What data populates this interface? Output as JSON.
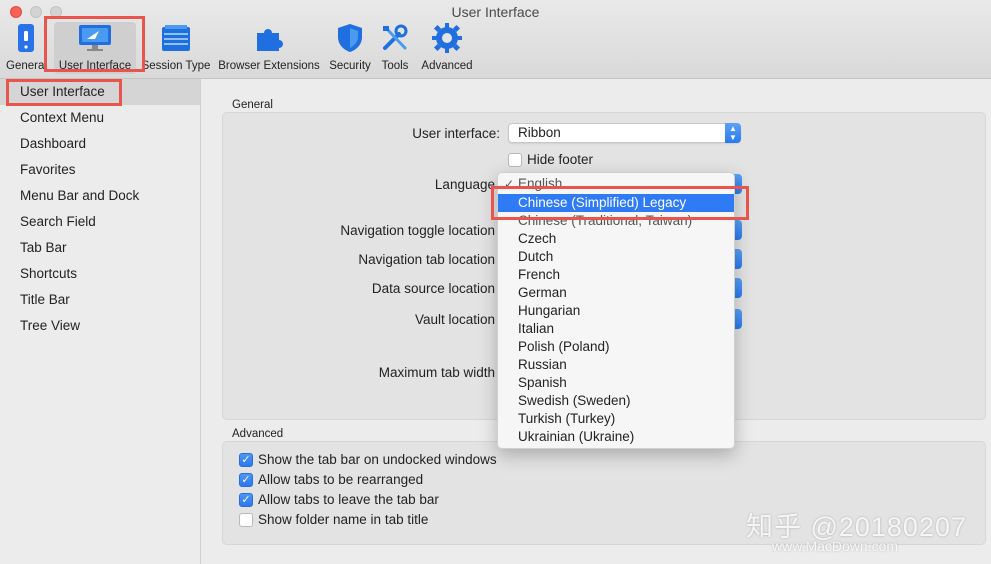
{
  "window": {
    "title": "User Interface"
  },
  "toolbar": {
    "items": [
      {
        "label": "General"
      },
      {
        "label": "User Interface"
      },
      {
        "label": "Session Type"
      },
      {
        "label": "Browser Extensions"
      },
      {
        "label": "Security"
      },
      {
        "label": "Tools"
      },
      {
        "label": "Advanced"
      }
    ]
  },
  "sidebar": {
    "items": [
      {
        "label": "User Interface"
      },
      {
        "label": "Context Menu"
      },
      {
        "label": "Dashboard"
      },
      {
        "label": "Favorites"
      },
      {
        "label": "Menu Bar and Dock"
      },
      {
        "label": "Search Field"
      },
      {
        "label": "Tab Bar"
      },
      {
        "label": "Shortcuts"
      },
      {
        "label": "Title Bar"
      },
      {
        "label": "Tree View"
      }
    ]
  },
  "general": {
    "section_label": "General",
    "user_interface_label": "User interface:",
    "user_interface_value": "Ribbon",
    "hide_footer_label": "Hide footer",
    "language_label": "Language",
    "nav_toggle_label": "Navigation toggle location",
    "nav_tab_label": "Navigation tab location",
    "data_source_label": "Data source location",
    "vault_label": "Vault location",
    "max_tab_width_label": "Maximum tab width"
  },
  "language_menu": {
    "current": "English",
    "selected": "Chinese (Simplified) Legacy",
    "partial": "Chinese (Traditional, Taiwan)",
    "items": [
      "Czech",
      "Dutch",
      "French",
      "German",
      "Hungarian",
      "Italian",
      "Polish (Poland)",
      "Russian",
      "Spanish",
      "Swedish (Sweden)",
      "Turkish (Turkey)",
      "Ukrainian (Ukraine)"
    ]
  },
  "advanced": {
    "section_label": "Advanced",
    "options": [
      {
        "label": "Show the tab bar on undocked windows",
        "checked": true
      },
      {
        "label": "Allow tabs to be rearranged",
        "checked": true
      },
      {
        "label": "Allow tabs to leave the tab bar",
        "checked": true
      },
      {
        "label": "Show folder name in tab title",
        "checked": false
      }
    ]
  },
  "watermark": {
    "main": "知乎 @20180207",
    "site": "www.MacDown.com"
  },
  "colors": {
    "accent": "#2f7bf5",
    "highlight_box": "#e9554d"
  }
}
